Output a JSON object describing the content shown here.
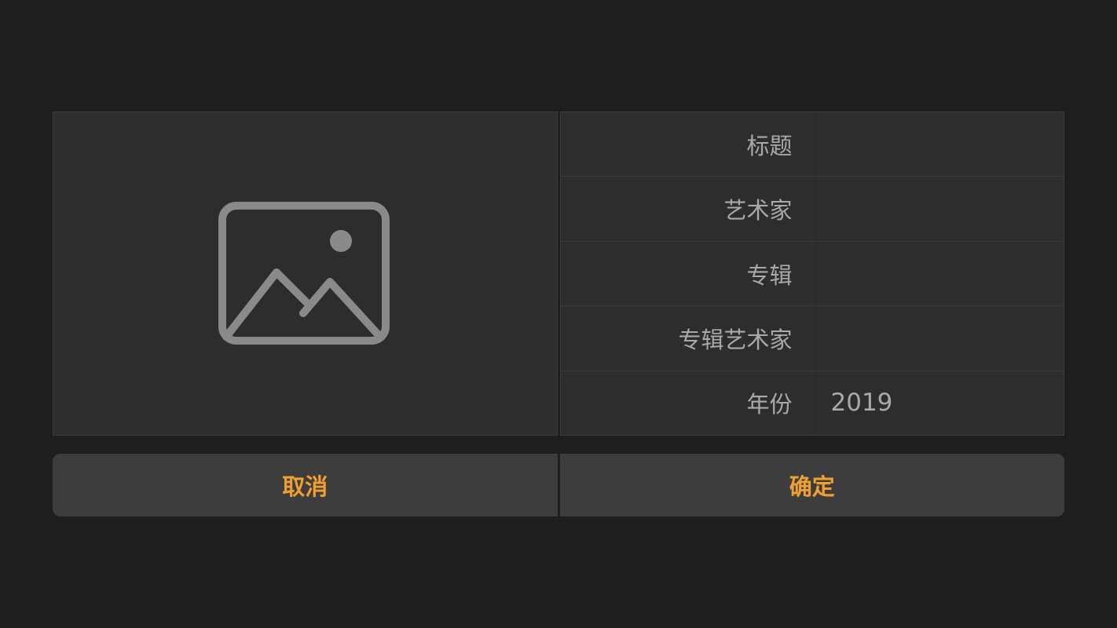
{
  "artwork": {
    "icon": "image-placeholder-icon",
    "icon_color": "#8a8a8a"
  },
  "fields": [
    {
      "label": "标题",
      "value": ""
    },
    {
      "label": "艺术家",
      "value": ""
    },
    {
      "label": "专辑",
      "value": ""
    },
    {
      "label": "专辑艺术家",
      "value": ""
    },
    {
      "label": "年份",
      "value": "2019"
    }
  ],
  "buttons": {
    "cancel_label": "取消",
    "confirm_label": "确定",
    "accent_color": "#f0a030"
  }
}
